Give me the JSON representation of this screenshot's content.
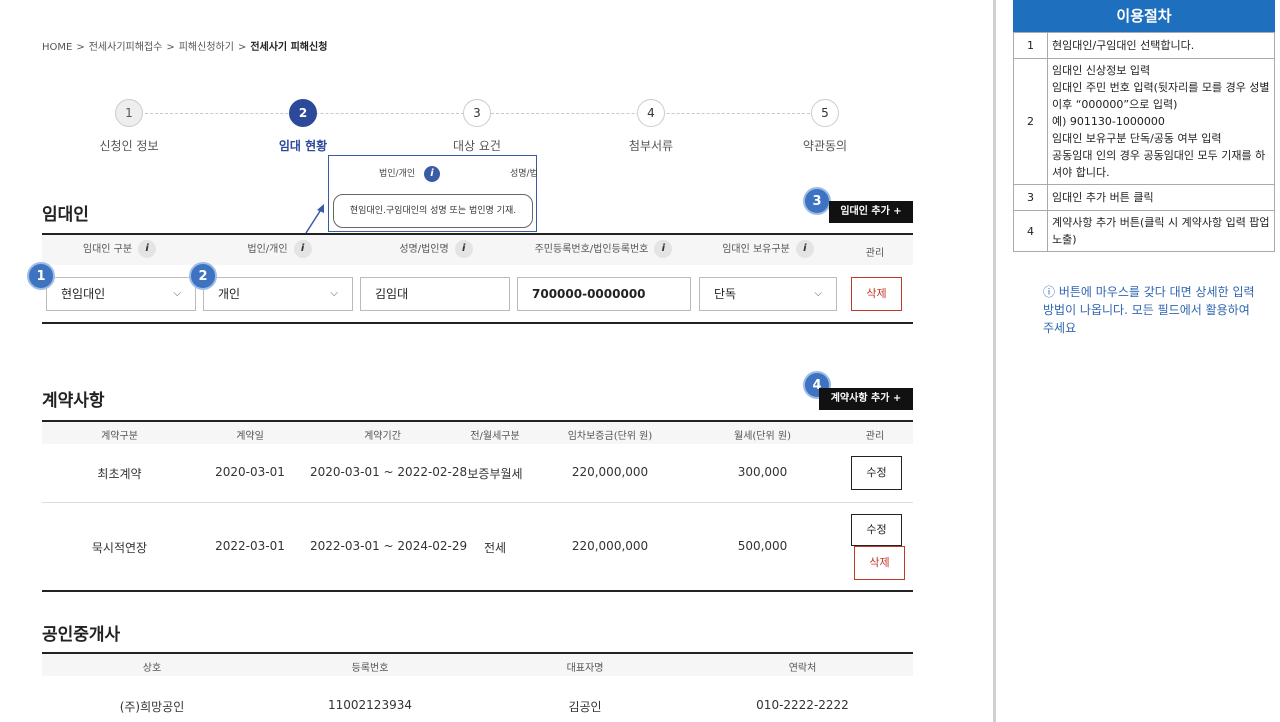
{
  "breadcrumb": [
    "HOME",
    "전세사기피해접수",
    "피해신청하기",
    "전세사기 피해신청"
  ],
  "steps": [
    {
      "num": "1",
      "label": "신청인 정보"
    },
    {
      "num": "2",
      "label": "임대 현황"
    },
    {
      "num": "3",
      "label": "대상 요건"
    },
    {
      "num": "4",
      "label": "첨부서류"
    },
    {
      "num": "5",
      "label": "약관동의"
    }
  ],
  "tooltip": {
    "col1": "법인/개인",
    "col2": "성명/법",
    "info": "i",
    "text": "현임대인.구임대인의 성명 또는 법인명 기재."
  },
  "landlord": {
    "title": "임대인",
    "add_button": "임대인 추가 +",
    "headers": [
      "임대인 구분",
      "법인/개인",
      "성명/법인명",
      "주민등록번호/법인등록번호",
      "임대인 보유구분",
      "관리"
    ],
    "row": {
      "type": "현임대인",
      "person": "개인",
      "name": "김임대",
      "id_number": "700000-0000000",
      "ownership": "단독",
      "delete": "삭제"
    }
  },
  "contract": {
    "title": "계약사항",
    "add_button": "계약사항 추가 +",
    "headers": [
      "계약구분",
      "계약일",
      "계약기간",
      "전/월세구분",
      "임차보증금(단위 원)",
      "월세(단위 원)",
      "관리"
    ],
    "rows": [
      {
        "kind": "최초계약",
        "date": "2020-03-01",
        "period": "2020-03-01 ~ 2022-02-28",
        "rent_type": "보증부월세",
        "deposit": "220,000,000",
        "monthly": "300,000",
        "edit": "수정"
      },
      {
        "kind": "묵시적연장",
        "date": "2022-03-01",
        "period": "2022-03-01 ~ 2024-02-29",
        "rent_type": "전세",
        "deposit": "220,000,000",
        "monthly": "500,000",
        "edit": "수정",
        "delete": "삭제"
      }
    ]
  },
  "broker": {
    "title": "공인중개사",
    "headers": [
      "상호",
      "등록번호",
      "대표자명",
      "연락처"
    ],
    "row": {
      "name": "(주)희망공인",
      "reg": "11002123934",
      "rep": "김공인",
      "phone": "010-2222-2222"
    }
  },
  "badges": [
    "1",
    "2",
    "3",
    "4"
  ],
  "procedure": {
    "title": "이용절차",
    "rows": [
      {
        "n": "1",
        "lines": [
          "현임대인/구임대인 선택합니다."
        ]
      },
      {
        "n": "2",
        "lines": [
          "임대인 신상정보 입력",
          "임대인 주민 번호 입력(뒷자리를 모를 경우 성별 이후 “000000”으로 입력)",
          "예) 901130-1000000",
          "임대인 보유구분 단독/공동 여부 입력",
          "공동임대 인의 경우 공동임대인 모두 기재를 하셔야 합니다."
        ]
      },
      {
        "n": "3",
        "lines": [
          "임대인 추가 버튼 클릭"
        ]
      },
      {
        "n": "4",
        "lines": [
          "계약사항 추가 버튼(클릭 시 계약사항 입력 팝업 노출)"
        ]
      }
    ],
    "note": "ⓘ 버튼에 마우스를 갖다 대면 상세한 입력 방법이 나옵니다. 모든 필드에서 활용하여 주세요"
  },
  "colors": {
    "accent": "#2d4a9a",
    "badge": "#3d73c0",
    "side_header": "#1f6fbf",
    "delete": "#c0392b"
  }
}
